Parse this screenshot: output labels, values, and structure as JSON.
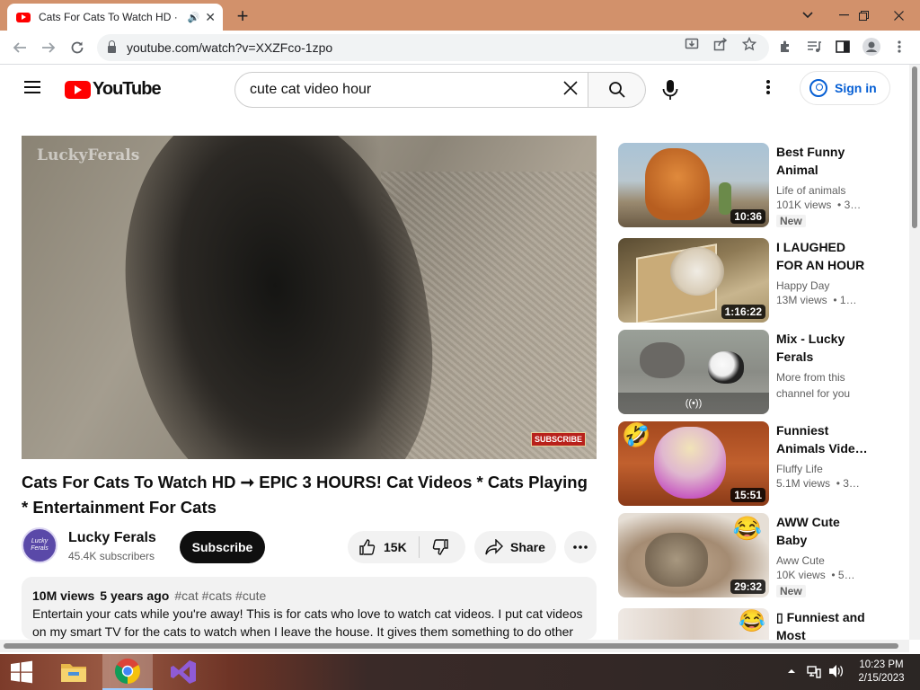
{
  "browser": {
    "tab_title": "Cats For Cats To Watch HD ·",
    "tab_audio": "🔊",
    "tab_close": "✕",
    "new_tab": "+",
    "url": "youtube.com/watch?v=XXZFco-1zpo"
  },
  "youtube": {
    "logo_text": "YouTube",
    "search_value": "cute cat video hour",
    "signin_label": "Sign in"
  },
  "video": {
    "watermark": "LuckyFerals",
    "subscribe_badge": "SUBSCRIBE",
    "title": "Cats For Cats To Watch HD ➞ EPIC 3 HOURS! Cat Videos * Cats Playing * Entertainment For Cats",
    "channel": "Lucky Ferals",
    "avatar_text": "Lucky Ferals",
    "subscribers": "45.4K subscribers",
    "subscribe_label": "Subscribe",
    "likes": "15K",
    "share_label": "Share",
    "views": "10M views",
    "age": "5 years ago",
    "tags": "#cat #cats #cute",
    "description": "Entertain your cats while you're away! This is for cats who love to watch cat videos. I put cat videos on my smart TV for the cats to watch when I leave the house. It gives them something to do other"
  },
  "recommendations": [
    {
      "title": "Best Funny Animal Video…",
      "channel": "Life of animals",
      "views": "101K views",
      "age": "3…",
      "duration": "10:36",
      "badge": "New",
      "colors": [
        "#9bb6c9",
        "#c96b2a"
      ]
    },
    {
      "title": "I LAUGHED FOR AN HOUR😹…",
      "channel": "Happy Day",
      "views": "13M views",
      "age": "1…",
      "duration": "1:16:22",
      "badge": "",
      "colors": [
        "#7a6a45",
        "#c9b48a"
      ]
    },
    {
      "title": "Mix - Lucky Ferals",
      "channel": "More from this channel for you",
      "views": "",
      "age": "",
      "duration": "",
      "badge": "",
      "mix_icon": "((•))",
      "colors": [
        "#8a8a86",
        "#ddd"
      ]
    },
    {
      "title": "Funniest Animals Vide…",
      "channel": "Fluffy Life",
      "views": "5.1M views",
      "age": "3…",
      "duration": "15:51",
      "badge": "",
      "emoji": "🤣",
      "colors": [
        "#b0532a",
        "#d88ad8"
      ]
    },
    {
      "title": "AWW Cute Baby Animals…",
      "channel": "Aww Cute",
      "views": "10K views",
      "age": "5…",
      "duration": "29:32",
      "badge": "New",
      "emoji": "😂",
      "colors": [
        "#c9b8a5",
        "#8a7a68"
      ]
    },
    {
      "title": "▯ Funniest and Most Hilariou…",
      "channel": "",
      "views": "",
      "age": "",
      "duration": "",
      "badge": "",
      "emoji": "😂",
      "colors": [
        "#e8e2dc",
        "#c9b6a8"
      ]
    }
  ],
  "taskbar": {
    "time": "10:23 PM",
    "date": "2/15/2023"
  }
}
